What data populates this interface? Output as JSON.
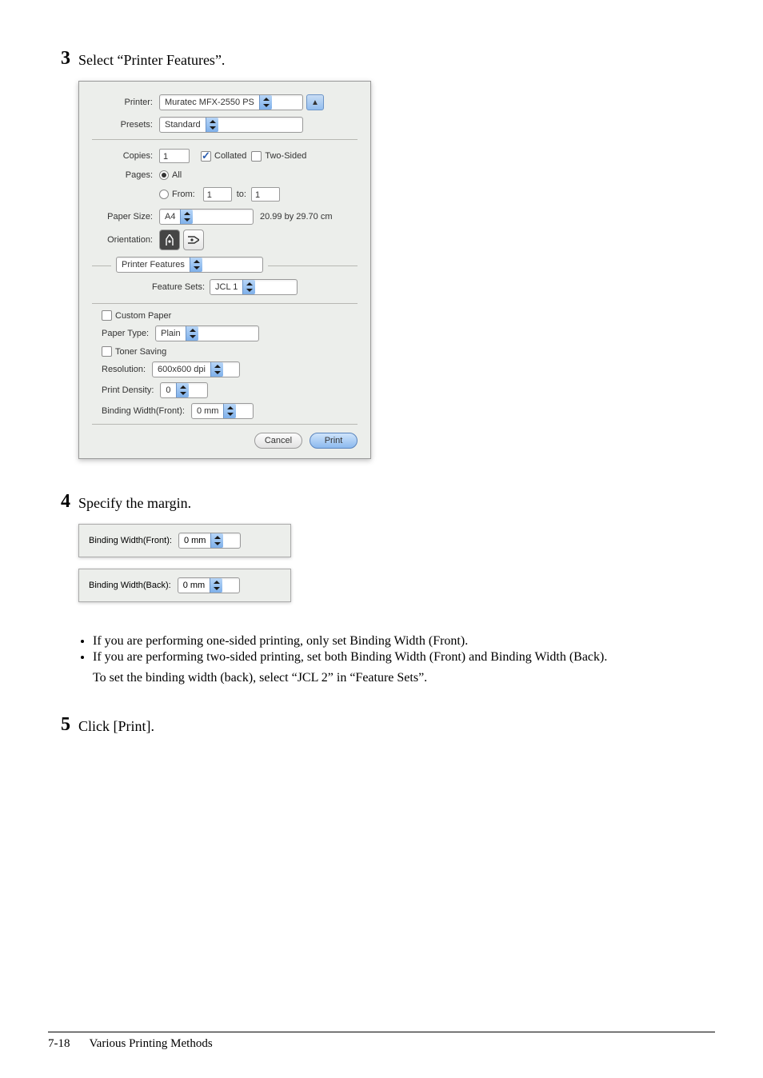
{
  "steps": {
    "s3": {
      "num": "3",
      "text": "Select “Printer Features”."
    },
    "s4": {
      "num": "4",
      "text": "Specify the margin."
    },
    "s5": {
      "num": "5",
      "text": "Click [Print]."
    }
  },
  "dialog": {
    "labels": {
      "printer": "Printer:",
      "presets": "Presets:",
      "copies": "Copies:",
      "pages": "Pages:",
      "from": "From:",
      "to": "to:",
      "paperSize": "Paper Size:",
      "orientation": "Orientation:",
      "featureSets": "Feature Sets:",
      "paperType": "Paper Type:",
      "resolution": "Resolution:",
      "printDensity": "Print Density:",
      "bindingFront": "Binding Width(Front):"
    },
    "printer": "Muratec MFX-2550 PS",
    "presets": "Standard",
    "copies": "1",
    "collated": "Collated",
    "twoSided": "Two-Sided",
    "pagesAll": "All",
    "fromVal": "1",
    "toVal": "1",
    "paperSize": "A4",
    "paperDims": "20.99 by 29.70 cm",
    "sectionName": "Printer Features",
    "featureSets": "JCL 1",
    "customPaper": "Custom Paper",
    "paperType": "Plain",
    "tonerSaving": "Toner Saving",
    "resolution": "600x600 dpi",
    "printDensity": "0",
    "bindingFront": "0 mm",
    "cancel": "Cancel",
    "print": "Print"
  },
  "snippets": {
    "front": {
      "label": "Binding Width(Front):",
      "value": "0 mm"
    },
    "back": {
      "label": "Binding Width(Back):",
      "value": "0 mm"
    }
  },
  "bullets": {
    "b1": "If you are performing one-sided printing, only set Binding Width (Front).",
    "b2": "If you are performing two-sided printing, set both Binding Width (Front) and Binding Width (Back).",
    "note": "To set the binding width (back), select “JCL 2” in “Feature Sets”."
  },
  "footer": {
    "page": "7-18",
    "title": "Various Printing Methods"
  }
}
